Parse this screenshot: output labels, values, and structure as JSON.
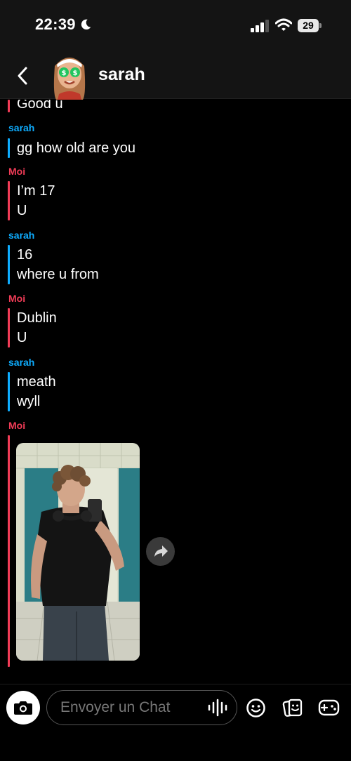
{
  "status_bar": {
    "time": "22:39",
    "battery": "29"
  },
  "header": {
    "contact_name": "sarah"
  },
  "messages": {
    "partial": {
      "text": "Good u"
    },
    "g1": {
      "sender": "sarah",
      "lines": [
        "gg how old are you"
      ]
    },
    "g2": {
      "sender": "Moi",
      "lines": [
        "I’m 17",
        "U"
      ]
    },
    "g3": {
      "sender": "sarah",
      "lines": [
        "16",
        "where u from"
      ]
    },
    "g4": {
      "sender": "Moi",
      "lines": [
        "Dublin",
        "U"
      ]
    },
    "g5": {
      "sender": "sarah",
      "lines": [
        "meath",
        "wyll"
      ]
    },
    "g6": {
      "sender": "Moi",
      "attachment": "photo"
    }
  },
  "composer": {
    "placeholder": "Envoyer un Chat"
  },
  "colors": {
    "me": "#f23c57",
    "them": "#0eadff",
    "background": "#000000",
    "header": "#141414"
  },
  "icons": [
    "moon-icon",
    "signal-icon",
    "wifi-icon",
    "battery-icon",
    "back-arrow-icon",
    "avatar",
    "share-icon",
    "camera-icon",
    "voice-icon",
    "emoji-icon",
    "sticker-icon",
    "game-icon"
  ]
}
